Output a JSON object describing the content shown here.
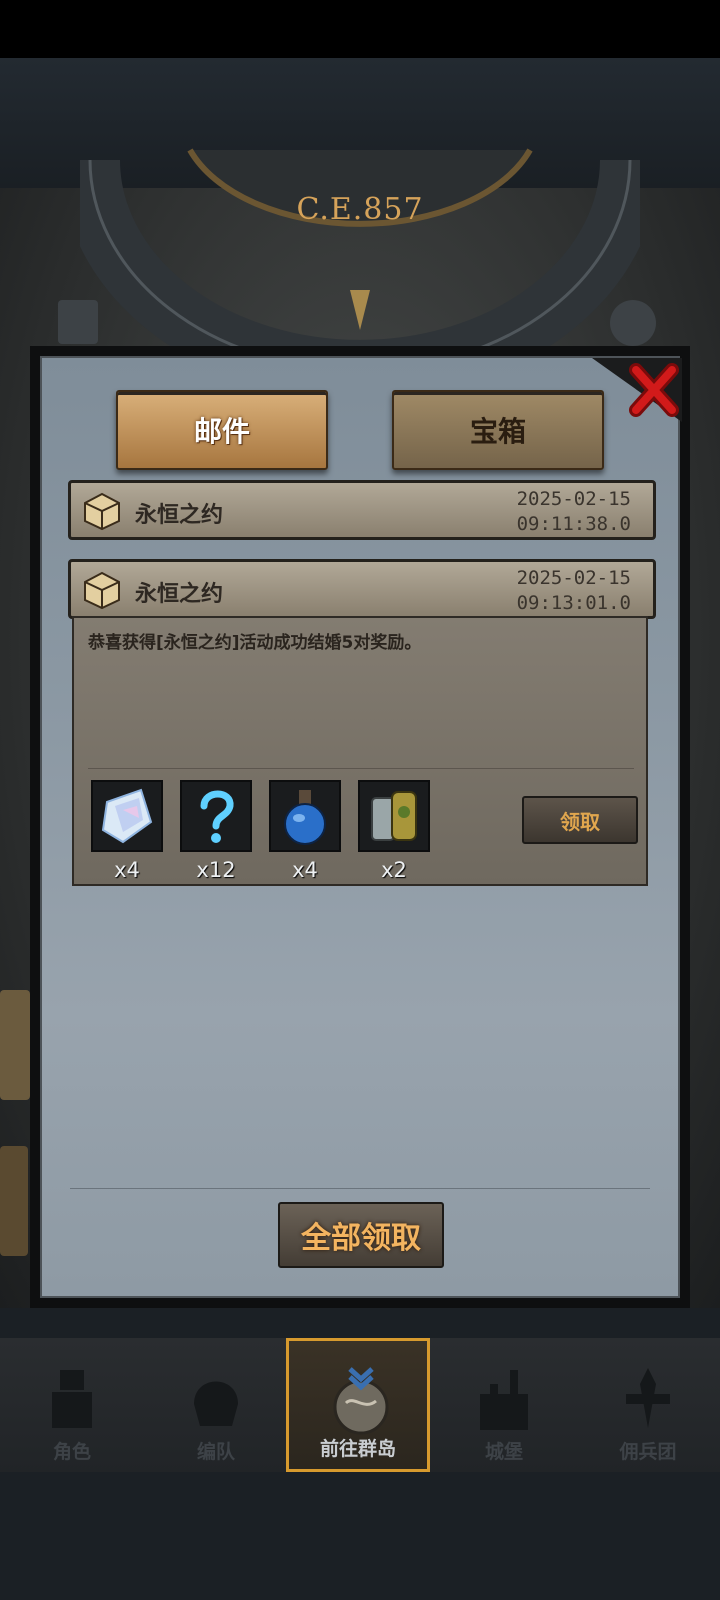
{
  "calendar": {
    "era": "C.E.857"
  },
  "tabs": {
    "mail": "邮件",
    "chest": "宝箱"
  },
  "mails": [
    {
      "title": "永恒之约",
      "date": "2025-02-15",
      "time": "09:11:38.0"
    },
    {
      "title": "永恒之约",
      "date": "2025-02-15",
      "time": "09:13:01.0"
    }
  ],
  "mail_body": {
    "message": "恭喜获得[永恒之约]活动成功结婚5对奖励。",
    "rewards": [
      {
        "icon": "crystal-icon",
        "count": "x4"
      },
      {
        "icon": "mystery-question-icon",
        "count": "x12"
      },
      {
        "icon": "blue-potion-icon",
        "count": "x4"
      },
      {
        "icon": "scroll-bottles-icon",
        "count": "x2"
      }
    ],
    "claim_label": "领取"
  },
  "claim_all_label": "全部领取",
  "nav": [
    {
      "label": "角色",
      "icon": "knight-icon"
    },
    {
      "label": "编队",
      "icon": "helmet-icon"
    },
    {
      "label": "前往群岛",
      "icon": "globe-icon"
    },
    {
      "label": "城堡",
      "icon": "castle-icon"
    },
    {
      "label": "佣兵团",
      "icon": "mercenary-icon"
    }
  ],
  "colors": {
    "accent": "#d79a2e",
    "claim_text": "#f3b460",
    "panel": "#8c99a4"
  }
}
